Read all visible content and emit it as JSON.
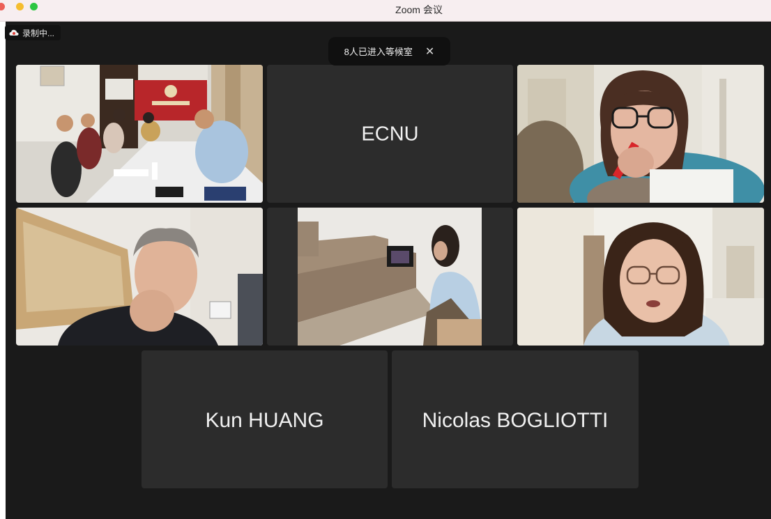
{
  "window": {
    "title": "Zoom 会议"
  },
  "recording": {
    "label": "录制中..."
  },
  "waiting_room": {
    "message": "8人已进入等候室",
    "close_glyph": "✕"
  },
  "participants": [
    {
      "name": "",
      "video": true
    },
    {
      "name": "ECNU",
      "video": false
    },
    {
      "name": "",
      "video": true,
      "active_speaker": true
    },
    {
      "name": "",
      "video": true
    },
    {
      "name": "",
      "video": true
    },
    {
      "name": "",
      "video": true
    },
    {
      "name": "Kun HUANG",
      "video": false
    },
    {
      "name": "Nicolas BOGLIOTTI",
      "video": false
    }
  ],
  "colors": {
    "active_border": "#2ecc40",
    "tile_bg": "#2c2c2c",
    "stage_bg": "#1a1a1a"
  }
}
